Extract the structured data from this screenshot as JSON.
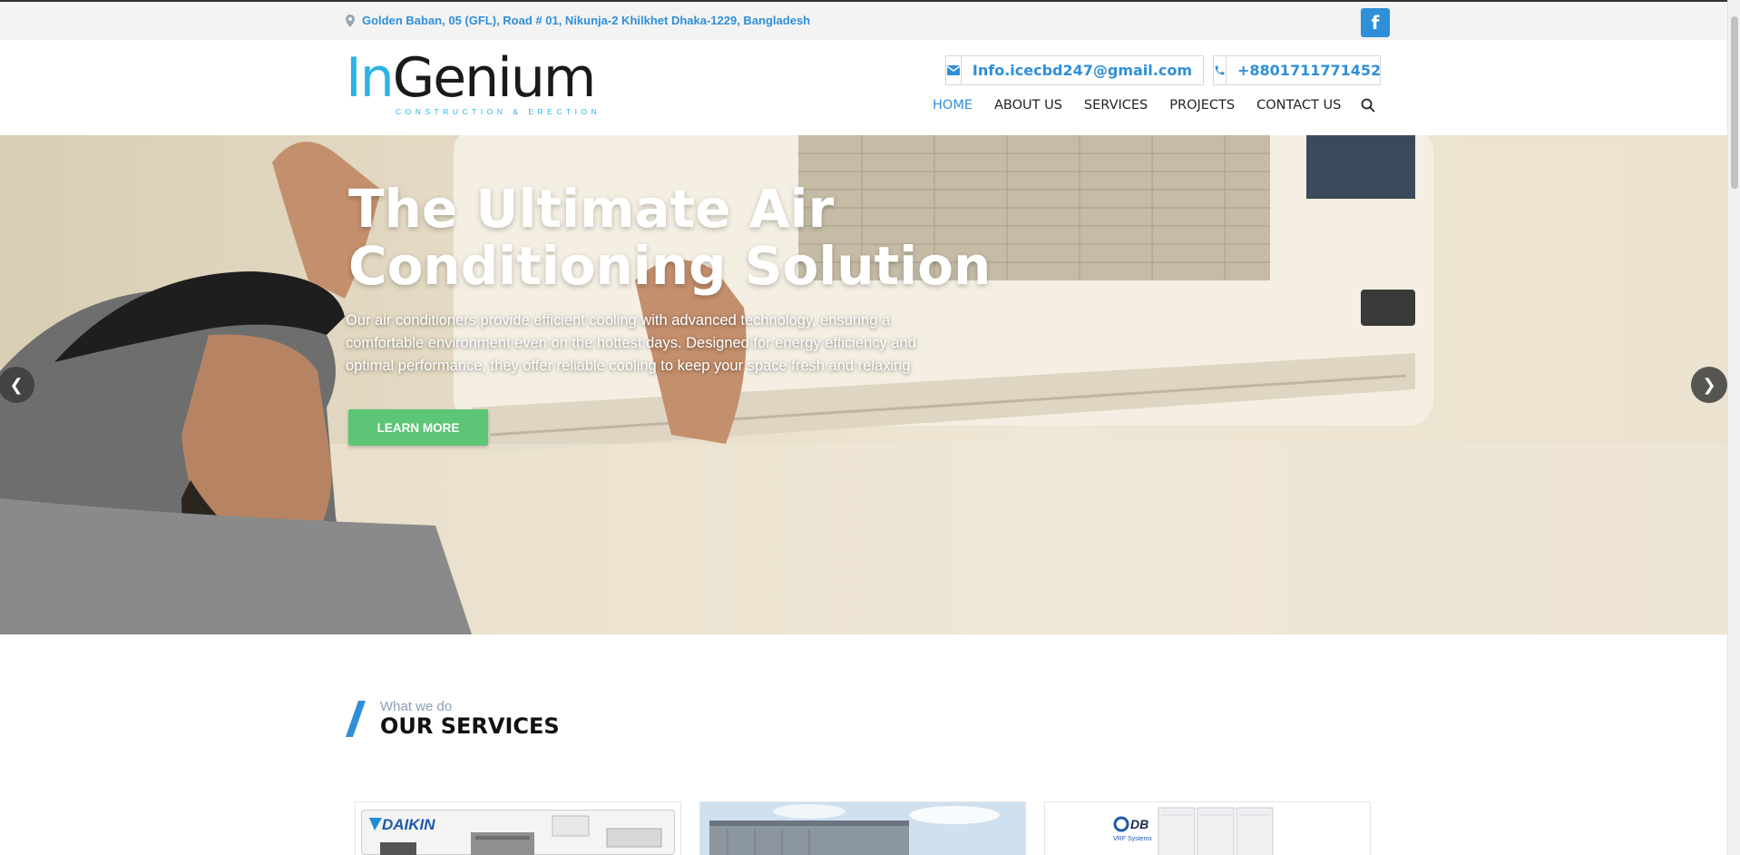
{
  "topbar": {
    "address": "Golden Baban, 05 (GFL), Road # 01, Nikunja-2 Khilkhet Dhaka-1229, Bangladesh",
    "facebook_icon": "facebook-icon"
  },
  "logo": {
    "brand_in": "In",
    "brand_rest": "Genium",
    "tagline": "CONSTRUCTION & ERECTION"
  },
  "contact": {
    "email": "Info.icecbd247@gmail.com",
    "phone": "+8801711771452"
  },
  "nav": {
    "items": [
      {
        "label": "HOME",
        "active": true
      },
      {
        "label": "ABOUT US",
        "active": false
      },
      {
        "label": "SERVICES",
        "active": false
      },
      {
        "label": "PROJECTS",
        "active": false
      },
      {
        "label": "CONTACT US",
        "active": false
      }
    ]
  },
  "hero": {
    "title": "The Ultimate Air Conditioning Solution",
    "description": "Our air conditioners provide efficient cooling with advanced technology, ensuring a comfortable environment even on the hottest days. Designed for energy efficiency and optimal performance, they offer reliable cooling to keep your space fresh and relaxing",
    "button": "LEARN MORE"
  },
  "services": {
    "subtitle": "What we do",
    "title": "OUR SERVICES",
    "cards": [
      {
        "brand": "DAIKIN"
      },
      {
        "brand": ""
      },
      {
        "brand": "DB",
        "caption": "VRF Systems"
      }
    ]
  },
  "colors": {
    "accent": "#2f8fd8",
    "logo_blue": "#2bb3e6",
    "button_green": "#5cc576"
  }
}
